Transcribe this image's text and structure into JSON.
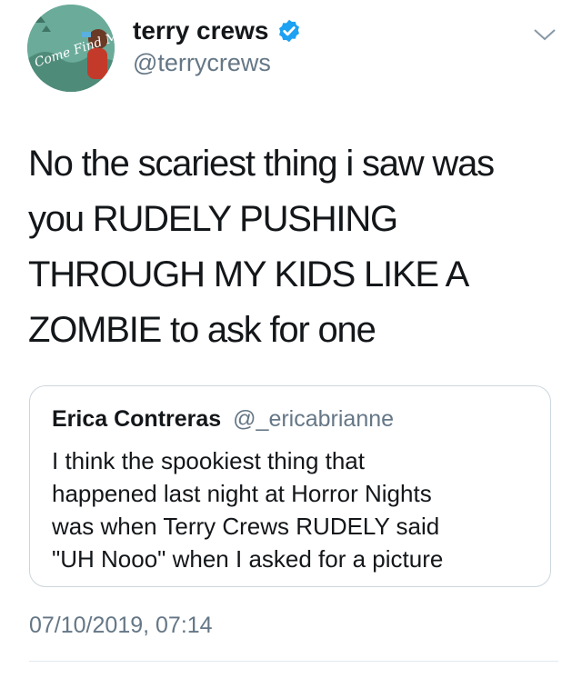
{
  "author": {
    "display_name": "terry crews",
    "handle": "@terrycrews",
    "avatar_text": "Come Find Me"
  },
  "tweet": {
    "lines": [
      "No the scariest thing i saw was",
      "you RUDELY PUSHING",
      "THROUGH MY KIDS LIKE A",
      "ZOMBIE to ask for one"
    ]
  },
  "quoted_tweet": {
    "display_name": "Erica Contreras",
    "handle": "@_ericabrianne",
    "lines": [
      "I think the spookiest thing that",
      "happened last night at Horror Nights",
      "was when Terry Crews RUDELY said",
      "\"UH Nooo\" when I asked for a picture"
    ]
  },
  "timestamp": "07/10/2019, 07:14",
  "colors": {
    "text": "#14171a",
    "secondary": "#657786",
    "verified": "#1da1f2",
    "border": "#ccd6dd"
  },
  "icons": [
    "verified-badge-icon",
    "chevron-down-icon"
  ]
}
